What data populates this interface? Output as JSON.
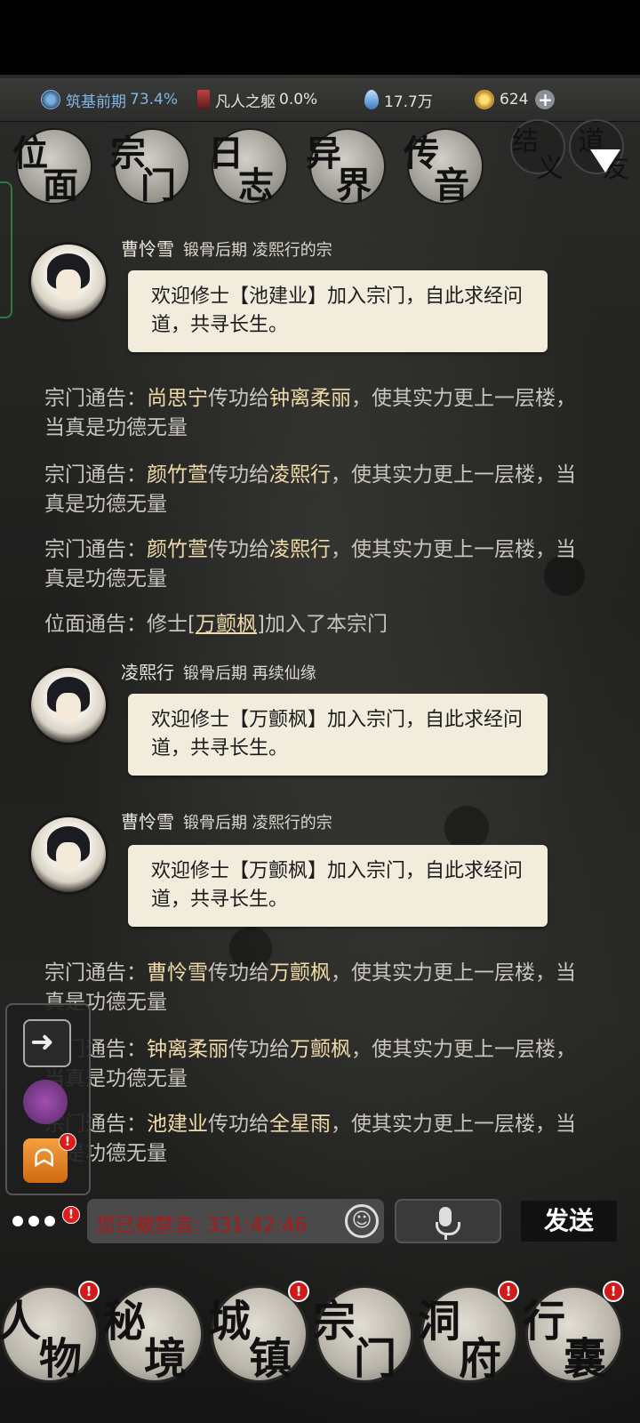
{
  "status": {
    "realm": "筑基前期",
    "realm_pct": "73.4%",
    "body": "凡人之躯",
    "body_pct": "0.0%",
    "spirit": "17.7万",
    "coins": "624"
  },
  "top_tabs": [
    {
      "a": "位",
      "b": "面"
    },
    {
      "a": "宗",
      "b": "门"
    },
    {
      "a": "日",
      "b": "志"
    },
    {
      "a": "异",
      "b": "界"
    },
    {
      "a": "传",
      "b": "音"
    }
  ],
  "friend_tab": {
    "a": "结",
    "b": "义",
    "c": "道",
    "d": "友"
  },
  "messages": [
    {
      "name": "曹怜雪",
      "info": "锻骨后期  凌熙行的宗",
      "text": "欢迎修士【池建业】加入宗门，自此求经问道，共寻长生。"
    },
    {
      "name": "凌熙行",
      "info": "锻骨后期  再续仙缘",
      "text": "欢迎修士【万颤枫】加入宗门，自此求经问道，共寻长生。"
    },
    {
      "name": "曹怜雪",
      "info": "锻骨后期  凌熙行的宗",
      "text": "欢迎修士【万颤枫】加入宗门，自此求经问道，共寻长生。"
    }
  ],
  "notices": [
    {
      "prefix": "宗门通告：",
      "from": "尚思宁",
      "mid": "传功给",
      "to": "钟离柔丽",
      "suffix": "，使其实力更上一层楼，当真是功德无量"
    },
    {
      "prefix": "宗门通告：",
      "from": "颜竹萱",
      "mid": "传功给",
      "to": "凌熙行",
      "suffix": "，使其实力更上一层楼，当真是功德无量"
    },
    {
      "prefix": "宗门通告：",
      "from": "颜竹萱",
      "mid": "传功给",
      "to": "凌熙行",
      "suffix": "，使其实力更上一层楼，当真是功德无量"
    },
    {
      "prefix": "位面通告：修士[",
      "from": "万颤枫",
      "mid": "]加入了本宗门",
      "to": "",
      "suffix": ""
    },
    {
      "prefix": "宗门通告：",
      "from": "曹怜雪",
      "mid": "传功给",
      "to": "万颤枫",
      "suffix": "，使其实力更上一层楼，当真是功德无量"
    },
    {
      "prefix": "宗门通告：",
      "from": "钟离柔丽",
      "mid": "传功给",
      "to": "万颤枫",
      "suffix": "，使其实力更上一层楼，当真是功德无量"
    },
    {
      "prefix": "宗门通告：",
      "from": "池建业",
      "mid": "传功给",
      "to": "全星雨",
      "suffix": "，使其实力更上一层楼，当真是功德无量"
    }
  ],
  "input": {
    "muted_text": "您已被禁言: 331:42:46"
  },
  "send_label": "发送",
  "bottom_nav": [
    {
      "a": "人",
      "b": "物"
    },
    {
      "a": "秘",
      "b": "境"
    },
    {
      "a": "城",
      "b": "镇"
    },
    {
      "a": "宗",
      "b": "门"
    },
    {
      "a": "洞",
      "b": "府"
    },
    {
      "a": "行",
      "b": "囊"
    }
  ],
  "badge_mark": "!"
}
